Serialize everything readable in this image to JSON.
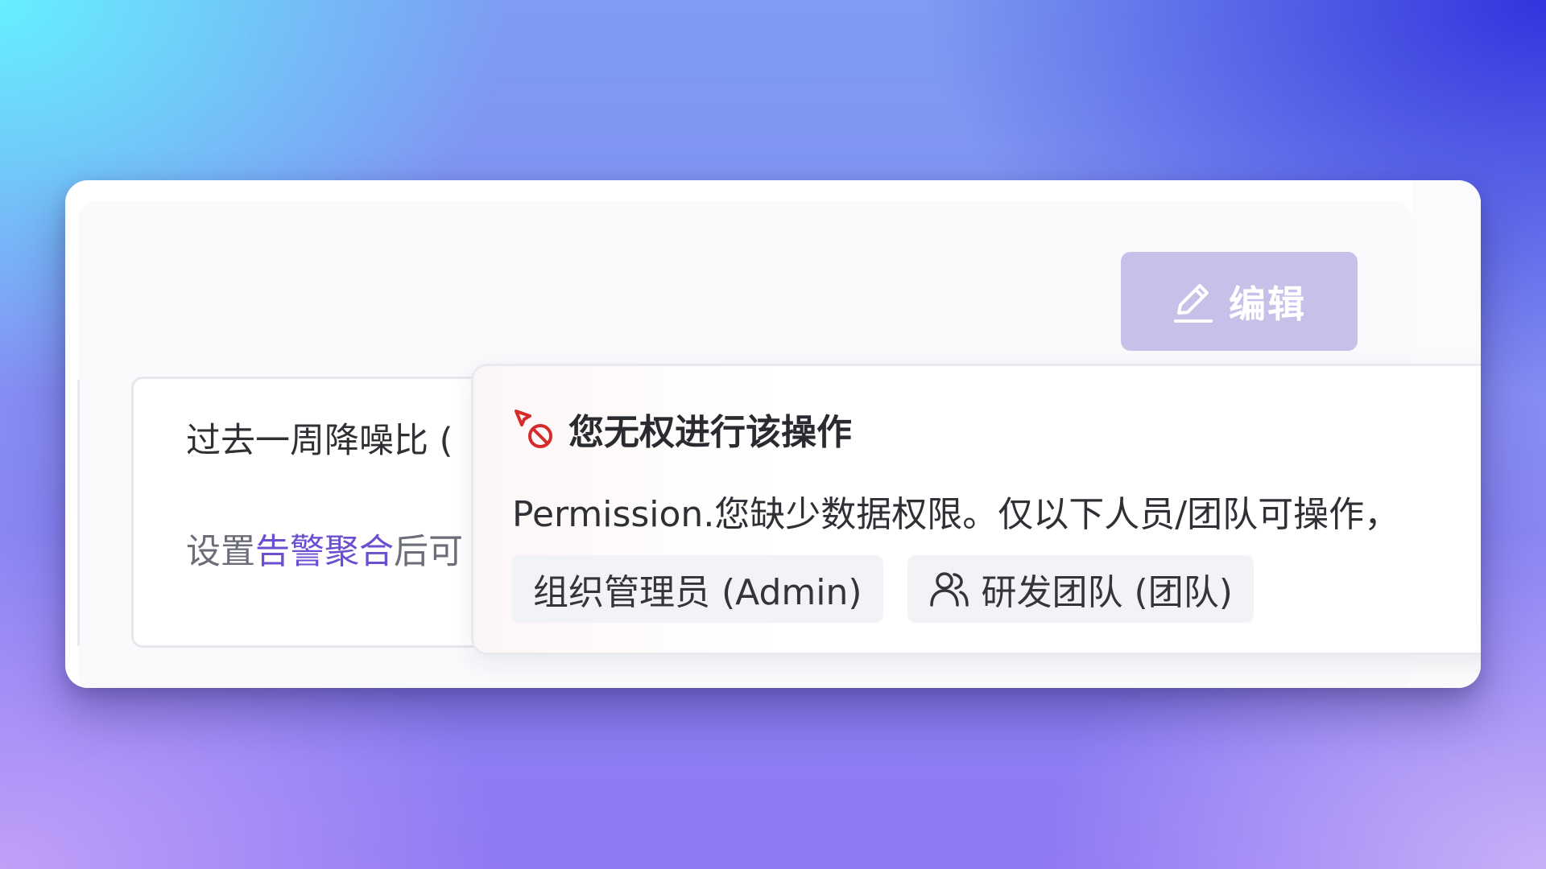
{
  "header": {
    "edit_button_label": "编辑",
    "edit_button_icon": "pencil-icon",
    "edit_button_state": "disabled"
  },
  "card": {
    "title": "过去一周降噪比 (",
    "description_prefix": "设置",
    "description_link": "告警聚合",
    "description_suffix": "后可"
  },
  "popover": {
    "icon": "no-permission-icon",
    "icon_color": "#d62b2b",
    "title": "您无权进行该操作",
    "message": "Permission.您缺少数据权限。仅以下人员/团队可操作，",
    "chips": [
      {
        "label": "组织管理员 (Admin)",
        "icon": ""
      },
      {
        "label": "研发团队 (团队)",
        "icon": "team-icon"
      }
    ]
  },
  "colors": {
    "accent": "#6b4fd0",
    "edit_button_bg": "#c7c1ea",
    "danger": "#d62b2b"
  }
}
